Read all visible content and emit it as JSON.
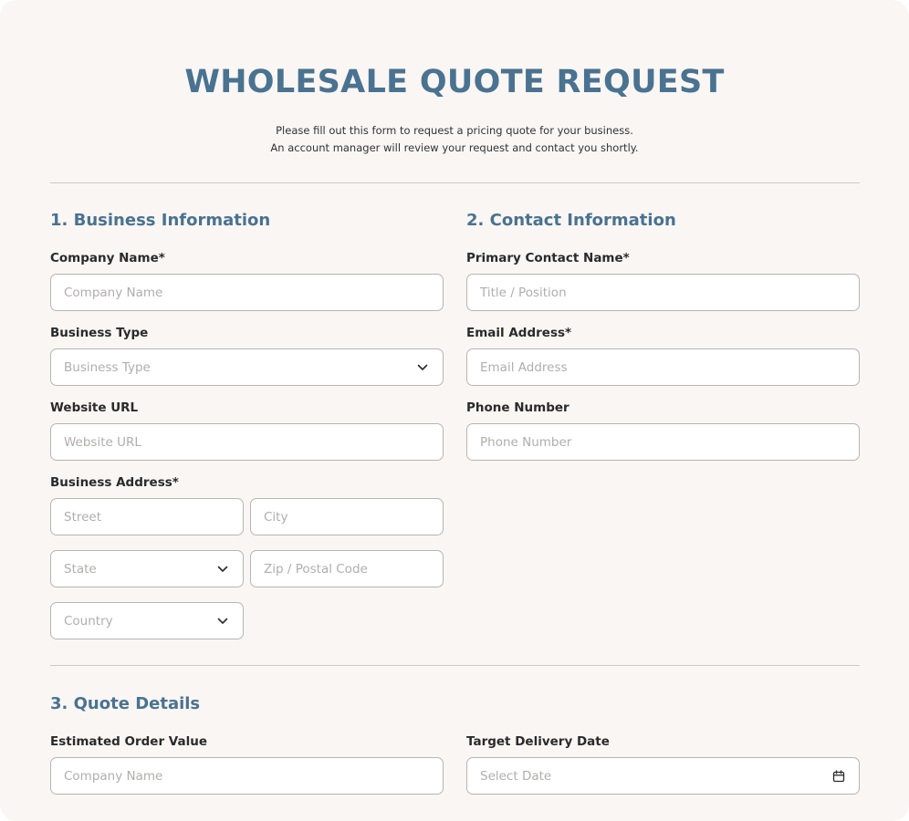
{
  "header": {
    "title": "WHOLESALE QUOTE REQUEST",
    "intro_line1": "Please fill out this form to request a pricing quote for your business.",
    "intro_line2": "An account manager will review your request and contact you shortly."
  },
  "business": {
    "title": "1. Business Information",
    "company_label": "Company Name*",
    "company_placeholder": "Company Name",
    "type_label": "Business Type",
    "type_placeholder": "Business Type",
    "website_label": "Website URL",
    "website_placeholder": "Website URL",
    "address_label": "Business Address*",
    "street_placeholder": "Street",
    "city_placeholder": "City",
    "state_placeholder": "State",
    "zip_placeholder": "Zip / Postal Code",
    "country_placeholder": "Country"
  },
  "contact": {
    "title": "2. Contact Information",
    "name_label": "Primary Contact Name*",
    "name_placeholder": "Title / Position",
    "email_label": "Email Address*",
    "email_placeholder": "Email Address",
    "phone_label": "Phone Number",
    "phone_placeholder": "Phone Number"
  },
  "quote": {
    "title": "3. Quote Details",
    "order_label": "Estimated Order Value",
    "order_placeholder": "Company Name",
    "date_label": "Target Delivery Date",
    "date_placeholder": "Select Date"
  },
  "icons": {
    "dropdown": "chevron-down-icon",
    "date": "calendar-icon"
  },
  "colors": {
    "accent": "#4a7291",
    "background": "#f9f6f3",
    "field_border": "#b8b5b1",
    "placeholder": "#b0aeab"
  }
}
